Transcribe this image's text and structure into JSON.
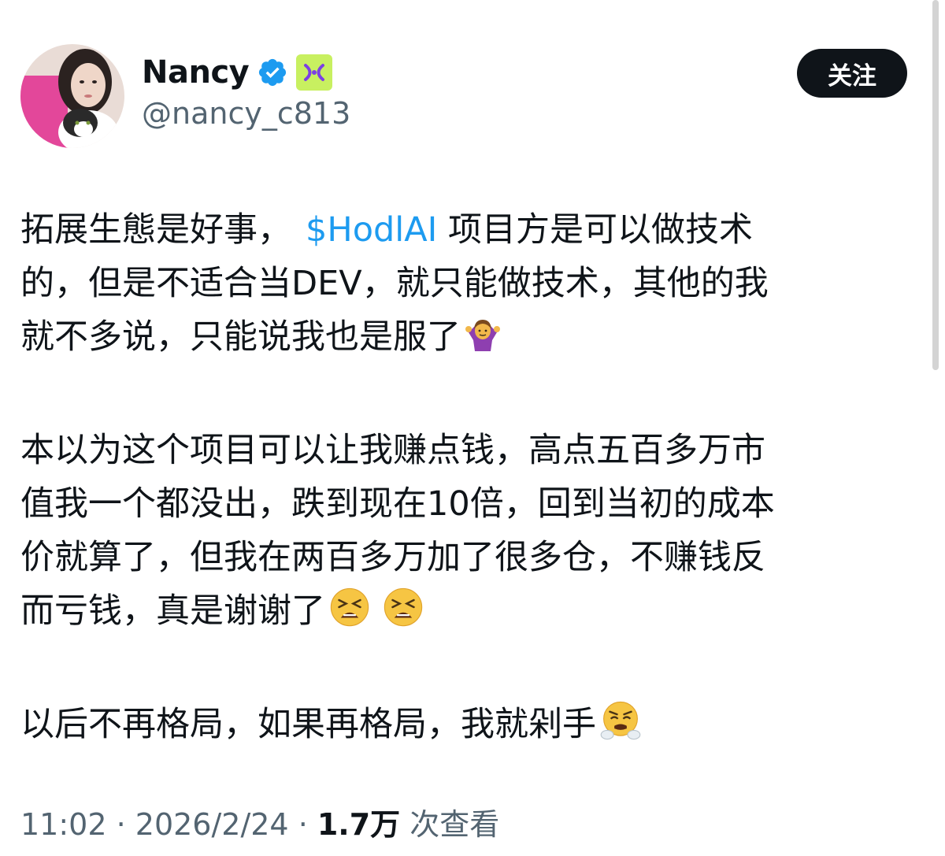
{
  "author": {
    "display_name": "Nancy",
    "handle": "@nancy_c813",
    "verified_icon": "blue-verified-check",
    "affiliate_badge_icon": "affiliate-badge",
    "avatar": "profile-photo-with-cat"
  },
  "follow_button": {
    "label": "关注"
  },
  "tweet": {
    "para1_before": "拓展生態是好事，",
    "cashtag": "$HodlAI",
    "para1_line1_after": " 项目方是可以做技术",
    "para1_line2": "的，但是不适合当DEV，就只能做技术，其他的我",
    "para1_line3": "就不多说，只能说我也是服了",
    "para1_emoji": "person-shrugging-emoji",
    "para2_line1": "本以为这个项目可以让我赚点钱，高点五百多万市",
    "para2_line2": "值我一个都没出，跌到现在10倍，回到当初的成本",
    "para2_line3": "价就算了，但我在两百多万加了很多仓，不赚钱反",
    "para2_line4": "而亏钱，真是谢谢了",
    "para2_emojis": [
      "tired-face-emoji",
      "tired-face-emoji"
    ],
    "para3": "以后不再格局，如果再格局，我就剁手",
    "para3_emoji": "face-with-steam-emoji"
  },
  "meta": {
    "time": "11:02",
    "separator": " · ",
    "date": "2026/2/24",
    "views_count": "1.7万",
    "views_label": " 次查看"
  },
  "colors": {
    "link": "#1d9bf0",
    "secondary_text": "#536471",
    "primary_text": "#0f1419",
    "verified": "#1d9bf0",
    "affiliate_badge_bg": "#c8f060"
  }
}
